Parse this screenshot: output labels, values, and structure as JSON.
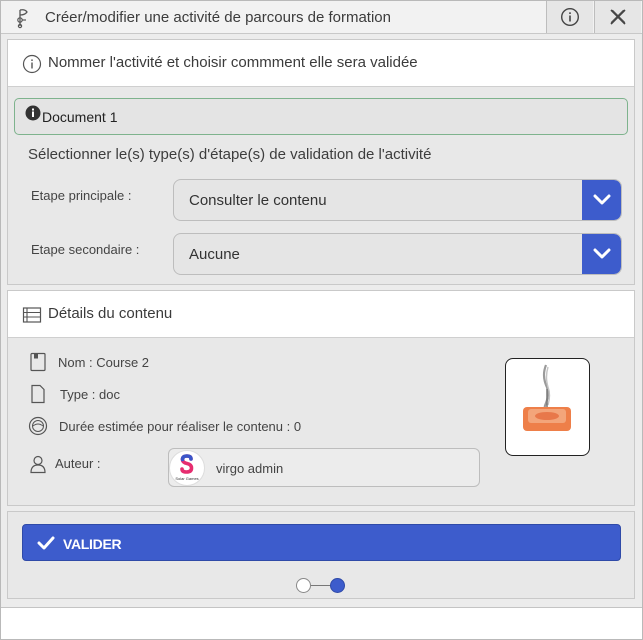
{
  "window": {
    "title": "Créer/modifier une activité de parcours de formation"
  },
  "section_activity": {
    "header": "Nommer l'activité et choisir commment elle sera validée",
    "document_name": "Document 1",
    "instruction": "Sélectionner le(s) type(s) d'étape(s) de validation de l'activité",
    "main_step_label": "Etape principale :",
    "main_step_value": "Consulter le contenu",
    "secondary_step_label": "Etape secondaire :",
    "secondary_step_value": "Aucune"
  },
  "section_details": {
    "header": "Détails du contenu",
    "name": "Nom : Course 2",
    "type": "Type : doc",
    "duration": "Durée estimée pour réaliser le contenu : 0",
    "author_label": "Auteur :",
    "author_name": "virgo admin",
    "avatar_brand": "Solar Games"
  },
  "actions": {
    "validate_label": "VALIDER"
  },
  "stepper": {
    "total_steps": 2,
    "current_step": 2
  },
  "colors": {
    "accent": "#3d5ccc",
    "success_border": "#7eb38d",
    "panel_bg": "#e8e8e8"
  },
  "icons": {
    "title": "flag-tree-icon",
    "info": "info-icon",
    "close": "close-icon",
    "list": "list-icon",
    "document": "file-icon",
    "type": "page-icon",
    "duration": "timer-icon",
    "author": "user-icon",
    "validate": "check-icon",
    "dropdown": "chevron-down-icon"
  }
}
